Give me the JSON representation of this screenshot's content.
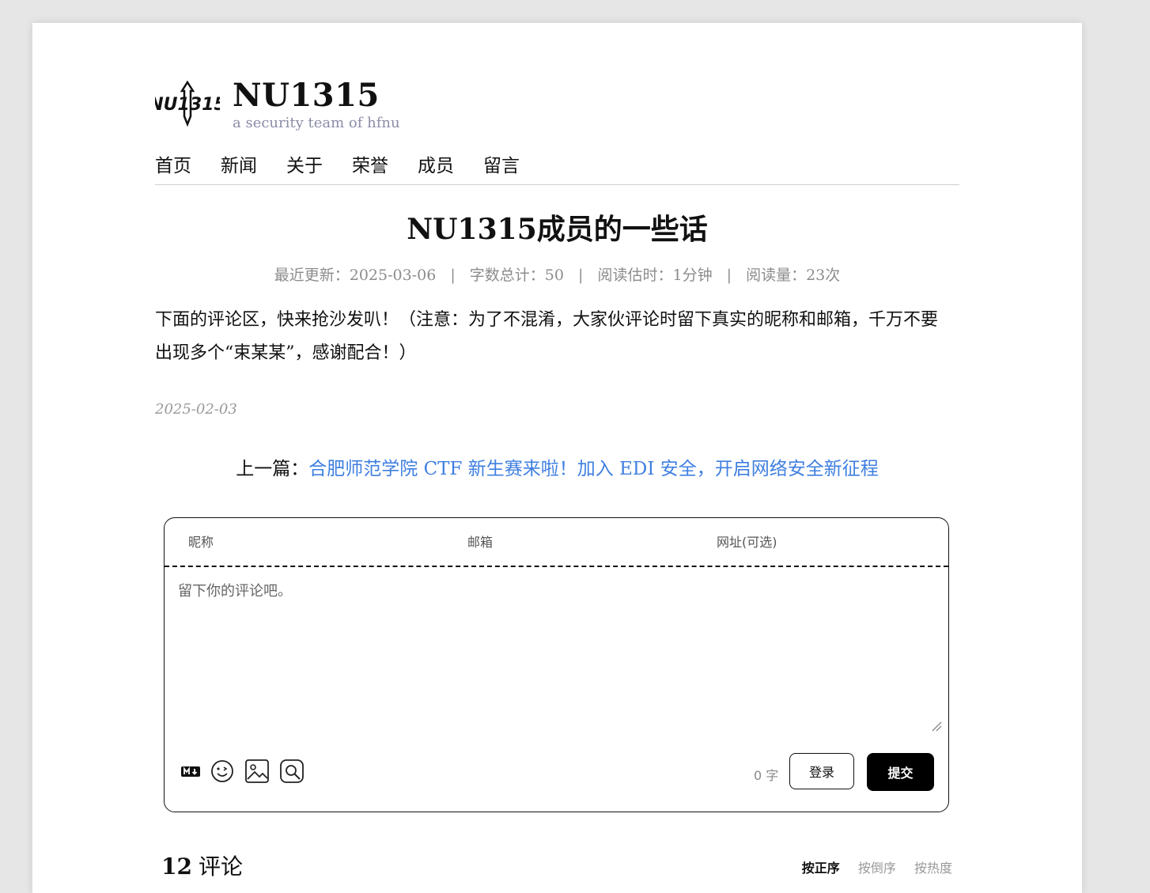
{
  "site": {
    "logo_text": "NU1315",
    "title": "NU1315",
    "subtitle": "a security team of hfnu"
  },
  "nav": [
    {
      "label": "首页"
    },
    {
      "label": "新闻"
    },
    {
      "label": "关于"
    },
    {
      "label": "荣誉"
    },
    {
      "label": "成员"
    },
    {
      "label": "留言"
    }
  ],
  "article": {
    "title": "NU1315成员的一些话",
    "meta": {
      "updated": "最近更新：2025-03-06",
      "words": "字数总计：50",
      "read_time": "阅读估时：1分钟",
      "views": "阅读量：23次",
      "separator": "|"
    },
    "content": "下面的评论区，快来抢沙发叭！（注意：为了不混淆，大家伙评论时留下真实的昵称和邮箱，千万不要出现多个“束某某”，感谢配合！）",
    "date": "2025-02-03"
  },
  "prev": {
    "prefix": "上一篇：",
    "link_text": "合肥师范学院 CTF 新生赛来啦！加入 EDI 安全，开启网络安全新征程"
  },
  "comment_form": {
    "nick_placeholder": "昵称",
    "mail_placeholder": "邮箱",
    "url_placeholder": "网址(可选)",
    "textarea_placeholder": "留下你的评论吧。",
    "tools": [
      "markdown-icon",
      "emoji-icon",
      "image-icon",
      "mention-icon"
    ],
    "word_count": "0 字",
    "login_label": "登录",
    "submit_label": "提交"
  },
  "comments": {
    "count": "12",
    "label": "评论",
    "sort": [
      {
        "label": "按正序",
        "active": true
      },
      {
        "label": "按倒序",
        "active": false
      },
      {
        "label": "按热度",
        "active": false
      }
    ]
  }
}
